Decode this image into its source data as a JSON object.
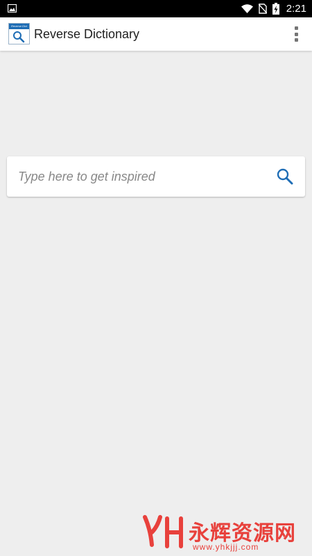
{
  "status_bar": {
    "time": "2:21",
    "left_icon": "image-icon",
    "right_icons": [
      "wifi-icon",
      "no-sim-icon",
      "battery-charging-icon"
    ]
  },
  "app_bar": {
    "title": "Reverse Dictionary",
    "logo_label": "Reverse Dict",
    "menu_icon": "overflow-menu-icon"
  },
  "search": {
    "placeholder": "Type here to get inspired",
    "value": "",
    "icon": "search-icon"
  },
  "watermark": {
    "text": "永辉资源网",
    "url": "www.yhkjjj.com"
  },
  "colors": {
    "accent": "#1e6db5",
    "background": "#eeeeee",
    "watermark": "#e8413c"
  }
}
